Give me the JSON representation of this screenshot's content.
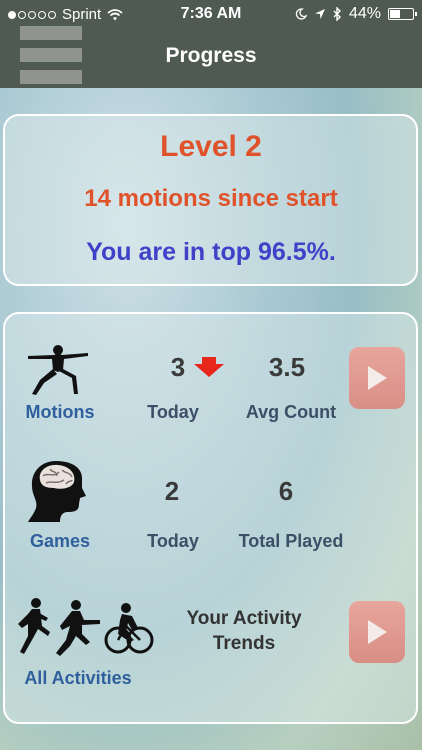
{
  "status_bar": {
    "carrier": "Sprint",
    "time": "7:36 AM",
    "battery": "44%",
    "battery_level": 0.44,
    "icons": [
      "signal-dots-icon",
      "wifi-icon",
      "moon-icon",
      "location-icon",
      "bluetooth-icon",
      "battery-icon"
    ]
  },
  "nav": {
    "title": "Progress",
    "menu_icon": "hamburger-menu-icon"
  },
  "summary": {
    "level": "Level 2",
    "motions_since_start": "14 motions since start",
    "rank": "You are in top 96.5%."
  },
  "motions": {
    "label": "Motions",
    "today_value": "3",
    "today_label": "Today",
    "avg_value": "3.5",
    "avg_label": "Avg Count",
    "trend_icon": "red-down-arrow-icon"
  },
  "games": {
    "label": "Games",
    "today_value": "2",
    "today_label": "Today",
    "total_value": "6",
    "total_label": "Total Played"
  },
  "activities": {
    "label": "All Activities",
    "trends_line1": "Your Activity",
    "trends_line2": "Trends"
  },
  "colors": {
    "nav_bg": "#4e5a52",
    "level_text": "#e0522a",
    "rank_text": "#3f42c8",
    "label_text": "#2f5f9c",
    "play_button": "#e7a59c",
    "down_arrow": "#e8261c"
  }
}
